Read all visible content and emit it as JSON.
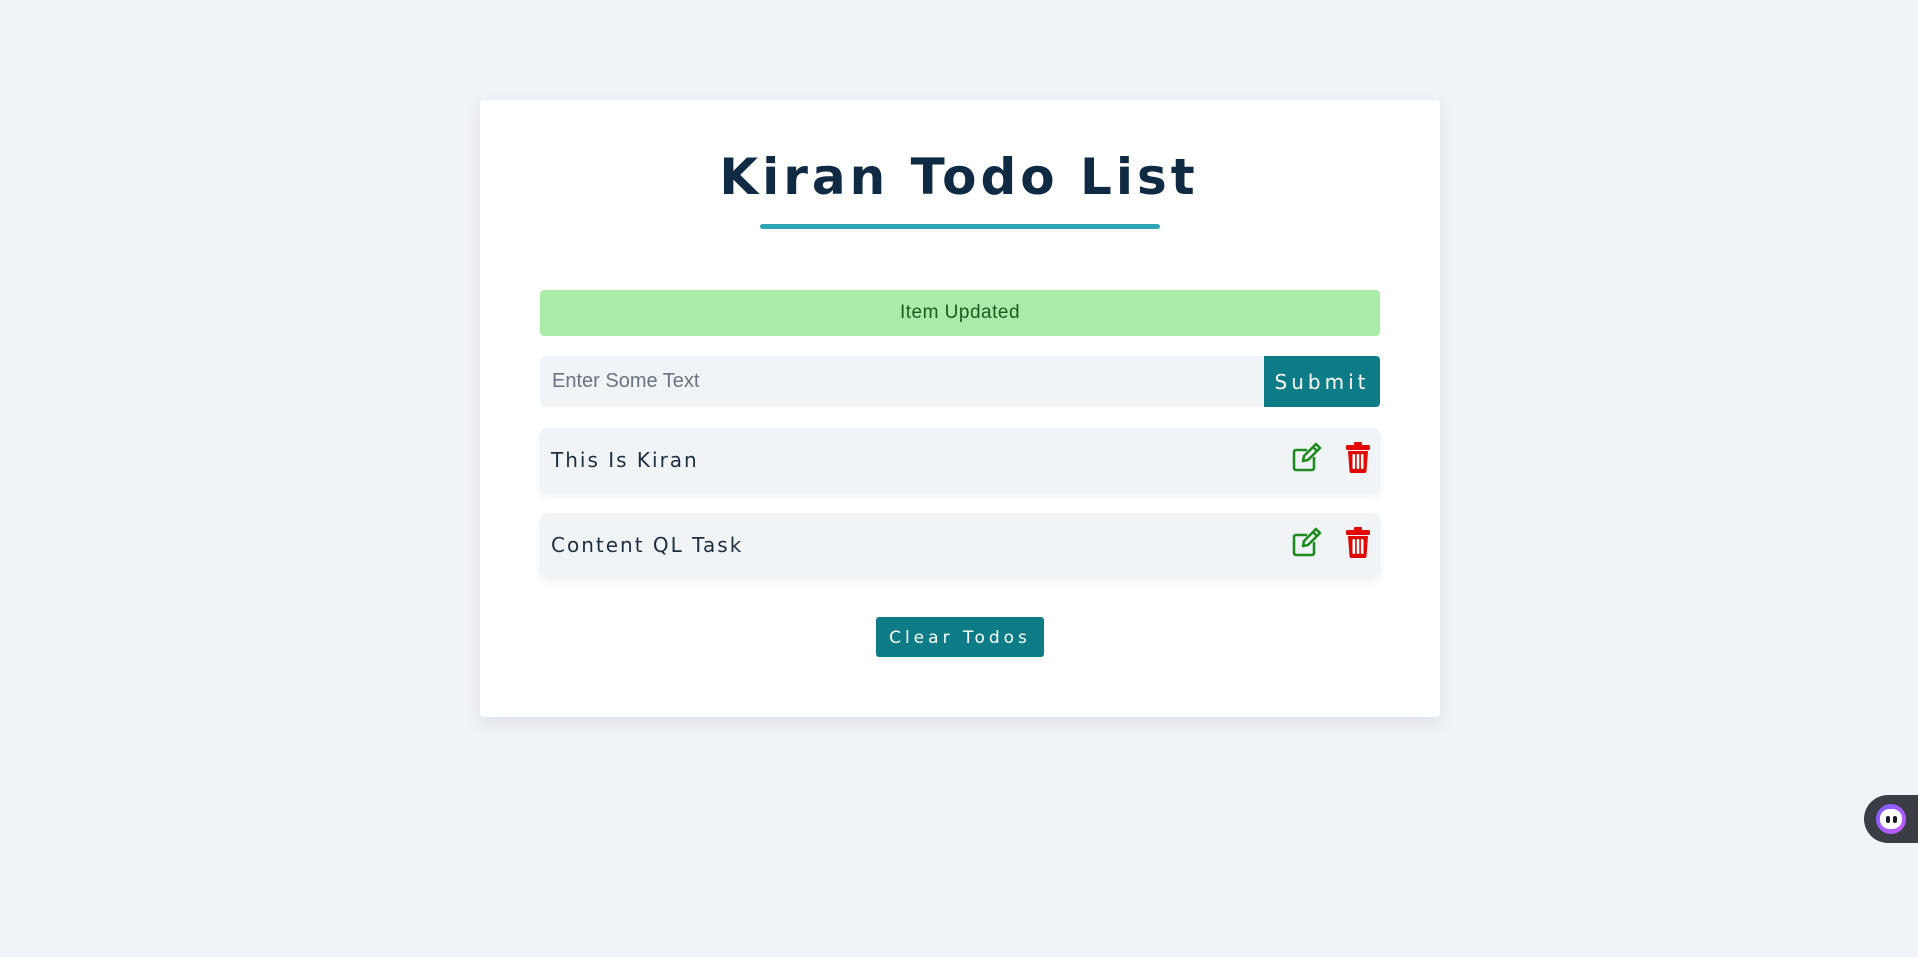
{
  "app": {
    "title": "Kiran Todo List"
  },
  "alert": {
    "text": "Item Updated",
    "color": "#abeba8"
  },
  "form": {
    "input_value": "",
    "input_placeholder": "Enter Some Text",
    "submit_label": "Submit"
  },
  "todos": [
    {
      "text": "This Is Kiran",
      "edit_icon": "edit-icon",
      "delete_icon": "trash-icon"
    },
    {
      "text": "Content QL Task",
      "edit_icon": "edit-icon",
      "delete_icon": "trash-icon"
    }
  ],
  "clear_label": "Clear Todos",
  "colors": {
    "accent": "#0e7c86",
    "title": "#102a43",
    "underline": "#2ca6b5",
    "edit": "#1f8a1f",
    "delete": "#e10600",
    "background": "#f1f4f7"
  }
}
